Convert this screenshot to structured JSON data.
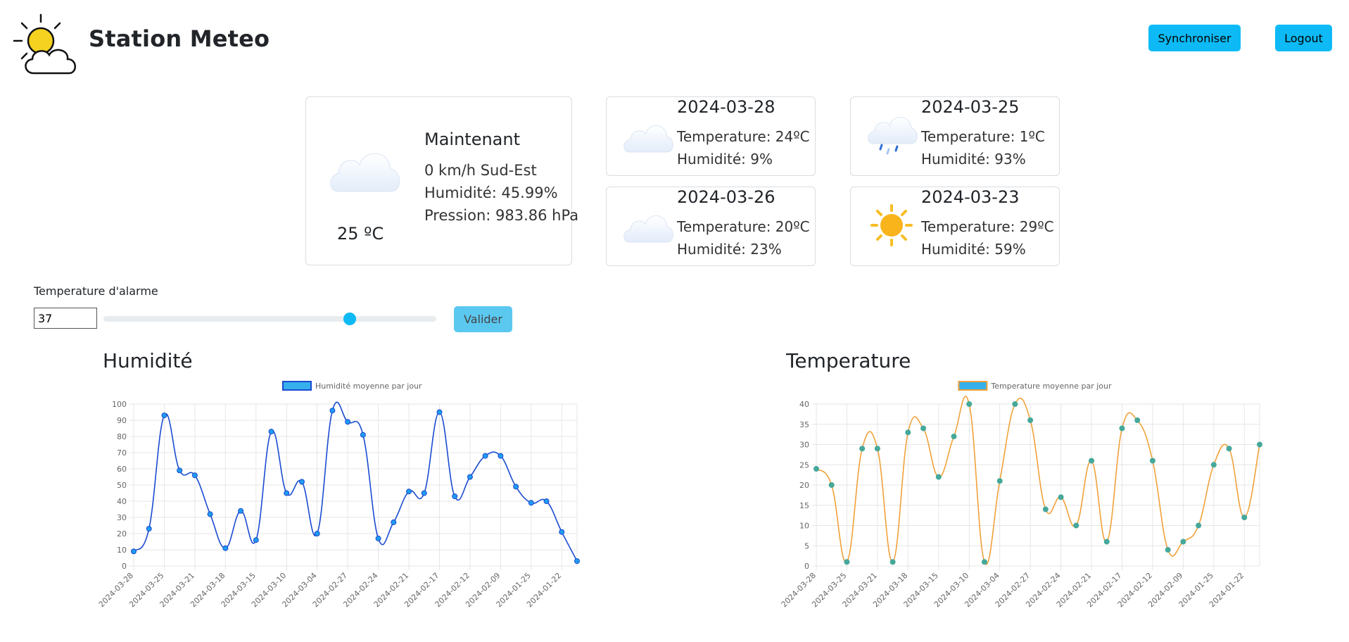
{
  "header": {
    "brand": "Station Meteo",
    "sync_label": "Synchroniser",
    "logout_label": "Logout",
    "logo_icon": "sun-cloud-icon"
  },
  "current": {
    "title": "Maintenant",
    "temperature": "25 ºC",
    "wind": "0 km/h  Sud-Est",
    "humidity": "Humidité: 45.99%",
    "pressure": "Pression: 983.86 hPa",
    "icon": "cloud-icon"
  },
  "forecast": [
    {
      "date": "2024-03-28",
      "temperature": "Temperature: 24ºC",
      "humidity": "Humidité: 9%",
      "icon": "cloud-icon"
    },
    {
      "date": "2024-03-25",
      "temperature": "Temperature: 1ºC",
      "humidity": "Humidité: 93%",
      "icon": "rain-cloud-icon"
    },
    {
      "date": "2024-03-26",
      "temperature": "Temperature: 20ºC",
      "humidity": "Humidité: 23%",
      "icon": "cloud-icon"
    },
    {
      "date": "2024-03-23",
      "temperature": "Temperature: 29ºC",
      "humidity": "Humidité: 59%",
      "icon": "sun-icon"
    }
  ],
  "alarm": {
    "label": "Temperature d'alarme",
    "value": "37",
    "slider_value": 37,
    "slider_min": 0,
    "slider_max": 50,
    "validate_label": "Valider"
  },
  "colors": {
    "accent": "#0dbaf5",
    "humidity_line": "#1a4bd1",
    "humidity_point": "#1f9bf0",
    "temperature_line": "#f0a13a",
    "temperature_point": "#45a89a",
    "legend_fill": "#36b0ec"
  },
  "chart_data": [
    {
      "type": "line",
      "title": "Humidité",
      "legend": "Humidité moyenne par jour",
      "ylim": [
        0,
        100
      ],
      "yticks": [
        0,
        10,
        20,
        30,
        40,
        50,
        60,
        70,
        80,
        90,
        100
      ],
      "tick_labels": [
        "2024-03-28",
        "2024-03-25",
        "2024-03-21",
        "2024-03-18",
        "2024-03-15",
        "2024-03-10",
        "2024-03-04",
        "2024-02-27",
        "2024-02-24",
        "2024-02-21",
        "2024-02-17",
        "2024-02-12",
        "2024-02-09",
        "2024-01-25",
        "2024-01-22"
      ],
      "values": [
        9,
        23,
        93,
        59,
        56,
        32,
        11,
        34,
        16,
        83,
        45,
        52,
        20,
        96,
        89,
        81,
        17,
        27,
        46,
        45,
        95,
        43,
        55,
        68,
        68,
        49,
        39,
        40,
        21,
        3
      ],
      "grid": true,
      "legend_position": "top"
    },
    {
      "type": "line",
      "title": "Temperature",
      "legend": "Temperature moyenne par jour",
      "ylim": [
        0,
        40
      ],
      "yticks": [
        0,
        5,
        10,
        15,
        20,
        25,
        30,
        35,
        40
      ],
      "tick_labels": [
        "2024-03-28",
        "2024-03-25",
        "2024-03-21",
        "2024-03-18",
        "2024-03-15",
        "2024-03-10",
        "2024-03-04",
        "2024-02-27",
        "2024-02-24",
        "2024-02-21",
        "2024-02-17",
        "2024-02-12",
        "2024-02-09",
        "2024-01-25",
        "2024-01-22"
      ],
      "values": [
        24,
        20,
        1,
        29,
        29,
        1,
        33,
        34,
        22,
        32,
        40,
        1,
        21,
        40,
        36,
        14,
        17,
        10,
        26,
        6,
        34,
        36,
        26,
        4,
        6,
        10,
        25,
        29,
        12,
        30
      ],
      "grid": true,
      "legend_position": "top"
    }
  ]
}
